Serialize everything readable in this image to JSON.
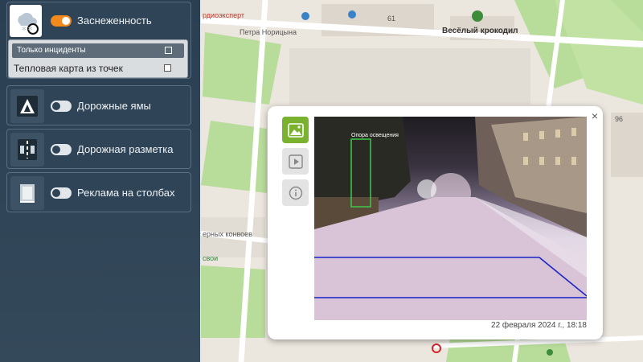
{
  "sidebar": {
    "layers": [
      {
        "label": "Заснеженность",
        "enabled": true,
        "icon": "snow-cloud-icon"
      },
      {
        "label": "Дорожные ямы",
        "enabled": false,
        "icon": "pothole-icon"
      },
      {
        "label": "Дорожная разметка",
        "enabled": false,
        "icon": "road-marking-icon"
      },
      {
        "label": "Реклама на столбах",
        "enabled": false,
        "icon": "pole-ad-icon"
      }
    ],
    "snow_options": {
      "only_incidents": "Только инциденты",
      "heatmap": "Тепловая карта из точек"
    }
  },
  "map": {
    "labels": {
      "street1": "Петра Норицына",
      "poi1": "Весёлый крокодил",
      "house": "61",
      "house2": "96",
      "poi2": "рдиоэксперт",
      "street2": "ерных конвоев",
      "poi3": "свои"
    }
  },
  "popup": {
    "close": "×",
    "detection_label": "Опора освещения",
    "date": "22 февраля 2024 г., 18:18",
    "tabs": [
      "photo-tab",
      "video-tab",
      "info-tab"
    ]
  },
  "colors": {
    "accent": "#f28a1d",
    "active_tab": "#7ab22f",
    "detect_box": "#3ecb4a",
    "lane_line": "#1a22c8"
  }
}
